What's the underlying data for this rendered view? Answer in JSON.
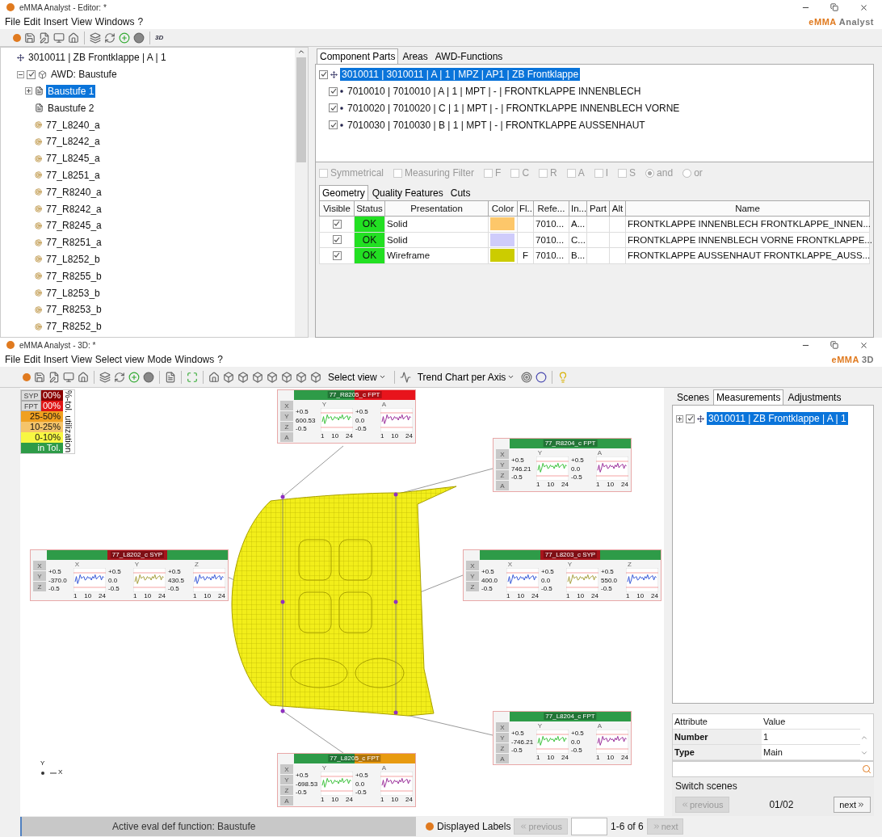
{
  "editor": {
    "title": "eMMA Analyst - Editor: *",
    "logo": {
      "brand": "eMMA",
      "product": "Analyst"
    },
    "menu": [
      "File",
      "Edit",
      "Insert",
      "View",
      "Windows",
      "?"
    ],
    "toolbar_badge": "3D",
    "tree": {
      "label": "3010011 | ZB Frontklappe | A | 1",
      "function": {
        "label": "AWD: Baustufe",
        "checked": true,
        "children": [
          {
            "label": "Baustufe 1",
            "kind": "stage",
            "selected": true,
            "expanded": false
          },
          {
            "label": "Baustufe 2",
            "kind": "stage",
            "selected": false
          },
          {
            "label": "77_L8240_a",
            "kind": "point",
            "selected": false
          },
          {
            "label": "77_L8242_a",
            "kind": "point",
            "selected": false
          },
          {
            "label": "77_L8245_a",
            "kind": "point",
            "selected": false
          },
          {
            "label": "77_L8251_a",
            "kind": "point",
            "selected": false
          },
          {
            "label": "77_R8240_a",
            "kind": "point",
            "selected": false
          },
          {
            "label": "77_R8242_a",
            "kind": "point",
            "selected": false
          },
          {
            "label": "77_R8245_a",
            "kind": "point",
            "selected": false
          },
          {
            "label": "77_R8251_a",
            "kind": "point",
            "selected": false
          },
          {
            "label": "77_L8252_b",
            "kind": "point",
            "selected": false
          },
          {
            "label": "77_R8255_b",
            "kind": "point",
            "selected": false
          },
          {
            "label": "77_L8253_b",
            "kind": "point",
            "selected": false
          },
          {
            "label": "77_R8253_b",
            "kind": "point",
            "selected": false
          },
          {
            "label": "77_R8252_b",
            "kind": "point",
            "selected": false
          }
        ]
      }
    },
    "tabs": [
      {
        "label": "Component Parts",
        "selected": true
      },
      {
        "label": "Areas",
        "selected": false
      },
      {
        "label": "AWD-Functions",
        "selected": false
      }
    ],
    "parts": {
      "label": "3010011 | 3010011 | A | 1 | MPZ | AP1 | ZB Frontklappe",
      "checked": true,
      "selected": true,
      "children": [
        {
          "label": "7010010 | 7010010 | A | 1 | MPT | - | FRONTKLAPPE INNENBLECH",
          "checked": true,
          "selected": false
        },
        {
          "label": "7010020 | 7010020 | C | 1 | MPT | - | FRONTKLAPPE INNENBLECH VORNE",
          "checked": true,
          "selected": false
        },
        {
          "label": "7010030 | 7010030 | B | 1 | MPT | - | FRONTKLAPPE AUSSENHAUT",
          "checked": true,
          "selected": false
        }
      ]
    },
    "filters": [
      {
        "label": "Symmetrical",
        "kind": "checkbox",
        "checked": false
      },
      {
        "label": "Measuring Filter",
        "kind": "checkbox",
        "checked": false
      },
      {
        "label": "F",
        "kind": "checkbox",
        "checked": false
      },
      {
        "label": "C",
        "kind": "checkbox",
        "checked": false
      },
      {
        "label": "R",
        "kind": "checkbox",
        "checked": false
      },
      {
        "label": "A",
        "kind": "checkbox",
        "checked": false
      },
      {
        "label": "I",
        "kind": "checkbox",
        "checked": false
      },
      {
        "label": "S",
        "kind": "checkbox",
        "checked": false
      },
      {
        "label": "and",
        "kind": "radio",
        "selected": true
      },
      {
        "label": "or",
        "kind": "radio",
        "selected": false
      }
    ],
    "filters_disabled": true,
    "subtabs": [
      {
        "label": "Geometry",
        "selected": true
      },
      {
        "label": "Quality Features",
        "selected": false
      },
      {
        "label": "Cuts",
        "selected": false
      }
    ],
    "table": {
      "columns": [
        "Visible",
        "Status",
        "Presentation",
        "Color",
        "Fl...",
        "Refe...",
        "In...",
        "Part",
        "Alt",
        "Name"
      ],
      "rows": [
        {
          "visible": true,
          "status": "OK",
          "presentation": "Solid",
          "color": "#fdc76a",
          "reference": "7010...",
          "index": "A...",
          "name": "FRONTKLAPPE INNENBLECH FRONTKLAPPE_INNEN..."
        },
        {
          "visible": true,
          "status": "OK",
          "presentation": "Solid",
          "color": "#cfccfb",
          "reference": "7010...",
          "index": "C...",
          "name": "FRONTKLAPPE INNENBLECH VORNE FRONTKLAPPE..."
        },
        {
          "visible": true,
          "status": "OK",
          "presentation": "Wireframe",
          "color": "#cccc00",
          "flag": "F",
          "reference": "7010...",
          "index": "B...",
          "name": "FRONTKLAPPE AUSSENHAUT FRONTKLAPPE_AUSS..."
        }
      ]
    }
  },
  "viewer": {
    "title": "eMMA Analyst - 3D: *",
    "logo": {
      "brand": "eMMA",
      "product": "3D"
    },
    "menu": [
      "File",
      "Edit",
      "Insert",
      "View",
      "Select view",
      "Mode",
      "Windows",
      "?"
    ],
    "dropdowns": [
      "Select view",
      "Trend Chart per Axis"
    ],
    "legend": {
      "title": "%-tol. utilization",
      "buttons": [
        "SYP",
        "FPT"
      ],
      "levels": [
        {
          "label": "00%",
          "color": "#8b0000"
        },
        {
          "label": "00%",
          "color": "#e01515"
        },
        {
          "label": "25-50%",
          "color": "#f0a020"
        },
        {
          "label": "10-25%",
          "color": "#f5c46a"
        },
        {
          "label": "0-10%",
          "color": "#f7f742"
        },
        {
          "label": "in Tol.",
          "color": "#2e9b48"
        }
      ]
    },
    "cards": [
      {
        "title": "77_R8205_c FPT",
        "segments": [
          {
            "color": "#2e9b48"
          },
          {
            "color": "#e8141c"
          }
        ],
        "axis_buttons": [
          "X",
          "Y",
          "Z",
          "A"
        ],
        "charts": [
          {
            "axis": "Y",
            "upper": "+0.5",
            "value": "600.53",
            "lower": "-0.5",
            "color": "#3cc23c",
            "xticks": [
              "1",
              "10",
              "24"
            ]
          },
          {
            "axis": "A",
            "upper": "+0.5",
            "value": "0.0",
            "lower": "-0.5",
            "color": "#9b2f9b",
            "xticks": [
              "1",
              "10",
              "24"
            ]
          }
        ]
      },
      {
        "title": "77_R8204_c FPT",
        "segments": [
          {
            "color": "#2e9b48"
          }
        ],
        "axis_buttons": [
          "X",
          "Y",
          "Z",
          "A"
        ],
        "charts": [
          {
            "axis": "Y",
            "upper": "+0.5",
            "value": "746.21",
            "lower": "-0.5",
            "color": "#3cc23c",
            "xticks": [
              "1",
              "10",
              "24"
            ]
          },
          {
            "axis": "A",
            "upper": "+0.5",
            "value": "0.0",
            "lower": "-0.5",
            "color": "#9b2f9b",
            "xticks": [
              "1",
              "10",
              "24"
            ]
          }
        ]
      },
      {
        "title": "77_L8202_c SYP",
        "segments": [
          {
            "color": "#2e9b48"
          },
          {
            "color": "#a8141c"
          },
          {
            "color": "#2e9b48"
          }
        ],
        "axis_buttons": [
          "X",
          "Y",
          "Z"
        ],
        "charts": [
          {
            "axis": "X",
            "upper": "+0.5",
            "value": "-370.0",
            "lower": "-0.5",
            "color": "#3a5ad8",
            "xticks": [
              "1",
              "10",
              "24"
            ]
          },
          {
            "axis": "Y",
            "upper": "+0.5",
            "value": "0.0",
            "lower": "-0.5",
            "color": "#a8a040",
            "xticks": [
              "1",
              "10",
              "24"
            ]
          },
          {
            "axis": "Z",
            "upper": "+0.5",
            "value": "430.5",
            "lower": "-0.5",
            "color": "#3a5ad8",
            "xticks": [
              "1",
              "10",
              "24"
            ]
          }
        ]
      },
      {
        "title": "77_L8203_c SYP",
        "segments": [
          {
            "color": "#2e9b48"
          },
          {
            "color": "#a8141c"
          },
          {
            "color": "#2e9b48"
          }
        ],
        "axis_buttons": [
          "X",
          "Y",
          "Z"
        ],
        "charts": [
          {
            "axis": "X",
            "upper": "+0.5",
            "value": "400.0",
            "lower": "-0.5",
            "color": "#3a5ad8",
            "xticks": [
              "1",
              "10",
              "24"
            ]
          },
          {
            "axis": "Y",
            "upper": "+0.5",
            "value": "0.0",
            "lower": "-0.5",
            "color": "#a8a040",
            "xticks": [
              "1",
              "10",
              "24"
            ]
          },
          {
            "axis": "Z",
            "upper": "+0.5",
            "value": "550.0",
            "lower": "-0.5",
            "color": "#3a5ad8",
            "xticks": [
              "1",
              "10",
              "24"
            ]
          }
        ]
      },
      {
        "title": "77_L8204_c FPT",
        "segments": [
          {
            "color": "#2e9b48"
          }
        ],
        "axis_buttons": [
          "X",
          "Y",
          "Z",
          "A"
        ],
        "charts": [
          {
            "axis": "Y",
            "upper": "+0.5",
            "value": "-746.21",
            "lower": "-0.5",
            "color": "#3cc23c",
            "xticks": [
              "1",
              "10",
              "24"
            ]
          },
          {
            "axis": "A",
            "upper": "+0.5",
            "value": "0.0",
            "lower": "-0.5",
            "color": "#9b2f9b",
            "xticks": [
              "1",
              "10",
              "24"
            ]
          }
        ]
      },
      {
        "title": "77_L8205_c FPT",
        "segments": [
          {
            "color": "#2e9b48"
          },
          {
            "color": "#e89a10"
          }
        ],
        "axis_buttons": [
          "X",
          "Y",
          "Z",
          "A"
        ],
        "charts": [
          {
            "axis": "Y",
            "upper": "+0.5",
            "value": "-698.53",
            "lower": "-0.5",
            "color": "#3cc23c",
            "xticks": [
              "1",
              "10",
              "24"
            ]
          },
          {
            "axis": "A",
            "upper": "+0.5",
            "value": "0.0",
            "lower": "-0.5",
            "color": "#9b2f9b",
            "xticks": [
              "1",
              "10",
              "24"
            ]
          }
        ]
      }
    ],
    "axes": {
      "vertical": "Y",
      "horizontal": "X"
    },
    "tabs": [
      {
        "label": "Scenes",
        "selected": false
      },
      {
        "label": "Measurements",
        "selected": true
      },
      {
        "label": "Adjustments",
        "selected": false
      }
    ],
    "tree_item": {
      "label": "3010011 | ZB Frontklappe | A | 1",
      "checked": true,
      "selected": true
    },
    "attributes": {
      "headers": [
        "Attribute",
        "Value"
      ],
      "rows": [
        [
          "Number",
          "1"
        ],
        [
          "Type",
          "Main"
        ]
      ]
    },
    "switch_scenes": {
      "title": "Switch scenes",
      "previous": {
        "label": "previous",
        "disabled": true
      },
      "page": "01/02",
      "next": {
        "label": "next",
        "disabled": false
      }
    },
    "status_bar": {
      "text": "Active eval def function: Baustufe",
      "labels_title": "Displayed Labels",
      "previous": {
        "label": "previous",
        "disabled": true
      },
      "range": "1-6 of 6",
      "next": {
        "label": "next",
        "disabled": true
      }
    }
  }
}
